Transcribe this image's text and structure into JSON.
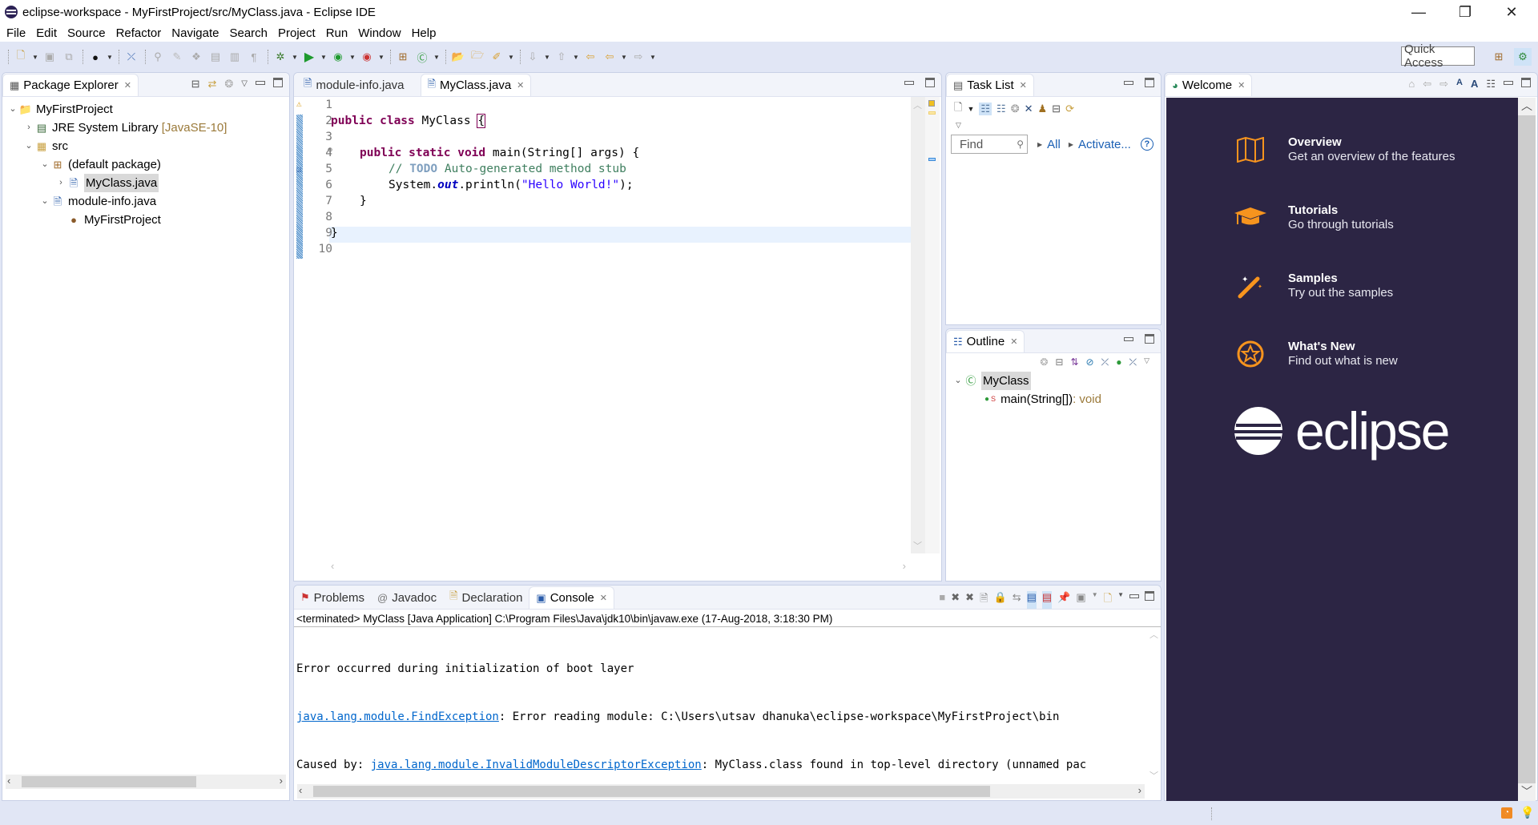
{
  "window": {
    "title": "eclipse-workspace - MyFirstProject/src/MyClass.java - Eclipse IDE",
    "controls": {
      "minimize": "—",
      "restore": "❐",
      "close": "✕"
    }
  },
  "menu": [
    "File",
    "Edit",
    "Source",
    "Refactor",
    "Navigate",
    "Search",
    "Project",
    "Run",
    "Window",
    "Help"
  ],
  "toolbar": {
    "quick_access": "Quick Access"
  },
  "package_explorer": {
    "tab_label": "Package Explorer",
    "tree": [
      {
        "label": "MyFirstProject",
        "level": 0,
        "expanded": true,
        "icon": "project-icon"
      },
      {
        "label": "JRE System Library",
        "decoration": "[JavaSE-10]",
        "level": 1,
        "expanded": false,
        "icon": "library-icon"
      },
      {
        "label": "src",
        "level": 1,
        "expanded": true,
        "icon": "source-folder-icon"
      },
      {
        "label": "(default package)",
        "level": 2,
        "expanded": true,
        "icon": "package-icon"
      },
      {
        "label": "MyClass.java",
        "level": 3,
        "expanded": false,
        "icon": "java-file-icon",
        "selected": true
      },
      {
        "label": "module-info.java",
        "level": 2,
        "expanded": true,
        "icon": "java-file-icon"
      },
      {
        "label": "MyFirstProject",
        "level": 3,
        "icon": "module-icon"
      }
    ]
  },
  "editor": {
    "tabs": [
      {
        "label": "module-info.java",
        "active": false
      },
      {
        "label": "MyClass.java",
        "active": true
      }
    ],
    "lines": [
      "1",
      "2",
      "3",
      "4",
      "5",
      "6",
      "7",
      "8",
      "9",
      "10"
    ],
    "code": {
      "l2_kw": "public class",
      "l2_name": " MyClass ",
      "l2_brace": "{",
      "l4_kw": "public static void",
      "l4_rest": " main(String[] args) {",
      "l5_comment_start": "// ",
      "l5_todo": "TODO",
      "l5_comment_rest": " Auto-generated method stub",
      "l6_a": "System.",
      "l6_field": "out",
      "l6_b": ".println(",
      "l6_str": "\"Hello World!\"",
      "l6_c": ");",
      "l7": "}",
      "l9": "}"
    }
  },
  "task_list": {
    "tab_label": "Task List",
    "find_placeholder": "Find",
    "all_label": "All",
    "activate_label": "Activate...",
    "help": "?"
  },
  "outline": {
    "tab_label": "Outline",
    "class_name": "MyClass",
    "method": "main(String[])",
    "method_return": " : void"
  },
  "welcome": {
    "tab_label": "Welcome",
    "items": [
      {
        "title": "Overview",
        "desc": "Get an overview of the features",
        "icon": "map-icon"
      },
      {
        "title": "Tutorials",
        "desc": "Go through tutorials",
        "icon": "graduation-cap-icon"
      },
      {
        "title": "Samples",
        "desc": "Try out the samples",
        "icon": "magic-wand-icon"
      },
      {
        "title": "What's New",
        "desc": "Find out what is new",
        "icon": "star-icon"
      }
    ],
    "logo_text": "eclipse",
    "colors": {
      "background": "#2c2544",
      "accent": "#f7941e"
    }
  },
  "console": {
    "tabs": [
      {
        "label": "Problems",
        "active": false
      },
      {
        "label": "Javadoc",
        "active": false
      },
      {
        "label": "Declaration",
        "active": false
      },
      {
        "label": "Console",
        "active": true
      }
    ],
    "status": "<terminated> MyClass [Java Application] C:\\Program Files\\Java\\jdk10\\bin\\javaw.exe (17-Aug-2018, 3:18:30 PM)",
    "line1": "Error occurred during initialization of boot layer",
    "line2_link": "java.lang.module.FindException",
    "line2_rest": ": Error reading module: C:\\Users\\utsav dhanuka\\eclipse-workspace\\MyFirstProject\\bin",
    "line3_prefix": "Caused by: ",
    "line3_link": "java.lang.module.InvalidModuleDescriptorException",
    "line3_rest": ": MyClass.class found in top-level directory (unnamed pac"
  }
}
